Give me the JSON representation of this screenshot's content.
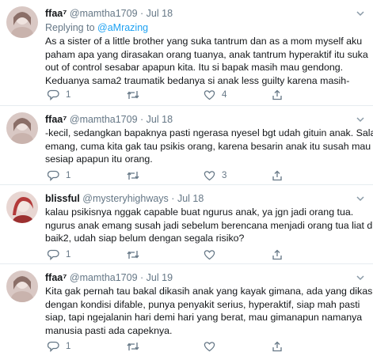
{
  "tweets": [
    {
      "name": "ffaa⁷",
      "handle": "@mamtha1709",
      "dot": "·",
      "date": "Jul 18",
      "reply_prefix": "Replying to ",
      "reply_handle": "@aMrazing",
      "lines": [
        "As a sister of a little brother yang suka tantrum dan as a mom myself aku",
        "paham apa yang dirasakan orang tuanya, anak tantrum hyperaktif itu suka",
        "out of control sesabar apapun kita. Itu si bapak masih mau gendong.",
        "Keduanya sama2 traumatik bedanya si anak less guilty karena masih-"
      ],
      "reply_count": "1",
      "retweet_count": "",
      "like_count": "4"
    },
    {
      "name": "ffaa⁷",
      "handle": "@mamtha1709",
      "dot": "·",
      "date": "Jul 18",
      "lines": [
        "-kecil, sedangkan bapaknya pasti ngerasa nyesel bgt udah gituin anak. Salah",
        "emang, cuma kita gak tau psikis orang, karena besarin anak itu susah mau",
        "sesiap apapun itu orang."
      ],
      "reply_count": "1",
      "retweet_count": "",
      "like_count": "3"
    },
    {
      "name": "blissful",
      "handle": "@mysteryhighways",
      "dot": "·",
      "date": "Jul 18",
      "lines": [
        "kalau psikisnya nggak capable buat  ngurus anak, ya jgn jadi orang tua.",
        "ngurus anak emang susah jadi sebelum berencana menjadi orang tua liat diri",
        "baik2, udah siap belum dengan segala risiko?"
      ],
      "reply_count": "1",
      "retweet_count": "",
      "like_count": ""
    },
    {
      "name": "ffaa⁷",
      "handle": "@mamtha1709",
      "dot": "·",
      "date": "Jul 19",
      "lines": [
        "Kita gak pernah tau bakal dikasih anak yang kayak gimana, ada yang dikasih",
        "dengan kondisi difable, punya penyakit serius, hyperaktif, siap mah pasti",
        "siap, tapi ngejalanin hari demi hari yang berat, mau gimanapun namanya",
        "manusia pasti ada capeknya."
      ],
      "reply_count": "1",
      "retweet_count": "",
      "like_count": ""
    }
  ],
  "icons": {
    "reply": "reply-icon",
    "retweet": "retweet-icon",
    "like": "heart-icon",
    "share": "share-icon",
    "more": "chevron-down-icon"
  },
  "colors": {
    "link": "#1da1f2",
    "secondary_text": "#657786",
    "divider": "#e6ecf0",
    "avatar_ffaa": "#d9c8c4",
    "avatar_blissful": "#e8d6d2"
  }
}
